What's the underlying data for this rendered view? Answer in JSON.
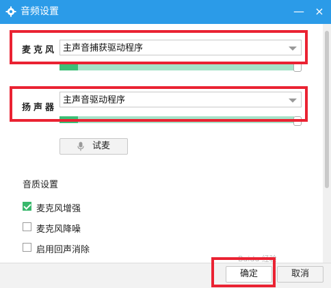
{
  "window": {
    "title": "音频设置",
    "close_glyph": "×",
    "minimize_glyph": "—"
  },
  "microphone": {
    "label": "麦克风",
    "device": "主声音捕获驱动程序",
    "level_fraction": 0.08
  },
  "speaker": {
    "label": "扬声器",
    "device": "主声音驱动程序",
    "level_fraction": 0.08
  },
  "test_mic_button": {
    "label": "试麦"
  },
  "quality": {
    "title": "音质设置",
    "options": [
      {
        "label": "麦克风增强",
        "checked": true
      },
      {
        "label": "麦克风降噪",
        "checked": false
      },
      {
        "label": "启用回声消除",
        "checked": false
      }
    ]
  },
  "footer": {
    "ok_label": "确定",
    "cancel_label": "取消"
  },
  "watermark": {
    "text": "Baidu 经验"
  },
  "colors": {
    "titlebar": "#2b9be8",
    "highlight": "#ea2232",
    "meter_bg": "#a6e2c8",
    "meter_fill": "#3cbf77"
  }
}
